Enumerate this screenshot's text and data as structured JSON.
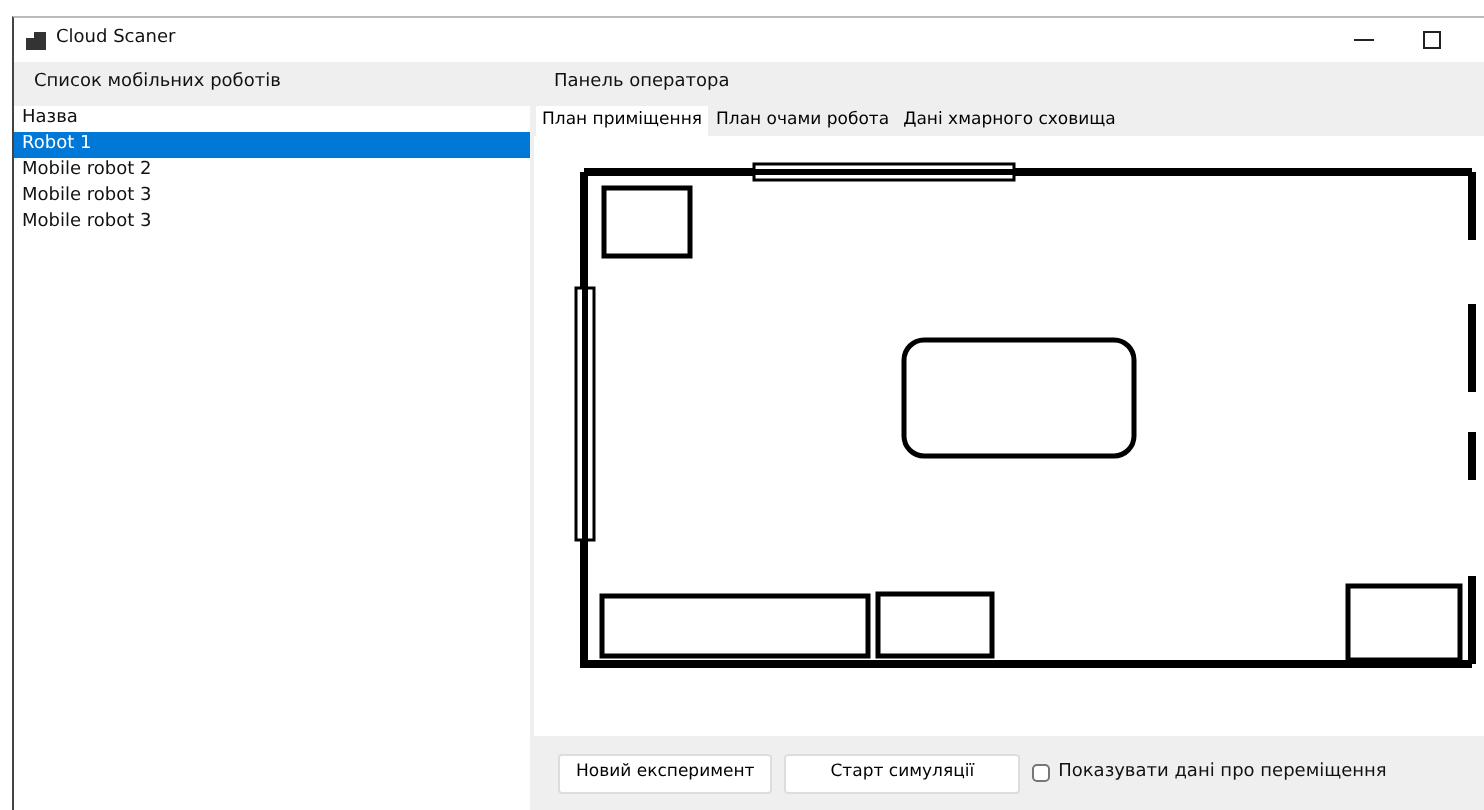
{
  "window": {
    "title": "Cloud Scaner"
  },
  "robots_panel": {
    "header": "Список мобільних роботів",
    "column": "Назва",
    "items": [
      {
        "label": "Robot 1",
        "selected": true
      },
      {
        "label": "Mobile robot 2",
        "selected": false
      },
      {
        "label": "Mobile robot 3",
        "selected": false
      },
      {
        "label": "Mobile robot 3",
        "selected": false
      }
    ]
  },
  "operator_panel": {
    "header": "Панель оператора",
    "tabs": [
      {
        "label": "План приміщення",
        "selected": true
      },
      {
        "label": "План очами робота",
        "selected": false
      },
      {
        "label": "Дані хмарного сховища",
        "selected": false
      }
    ],
    "buttons": [
      "Новий експеримент",
      "Старт симуляції"
    ],
    "checkbox": {
      "label": "Показувати дані про переміщення",
      "checked": false
    }
  }
}
